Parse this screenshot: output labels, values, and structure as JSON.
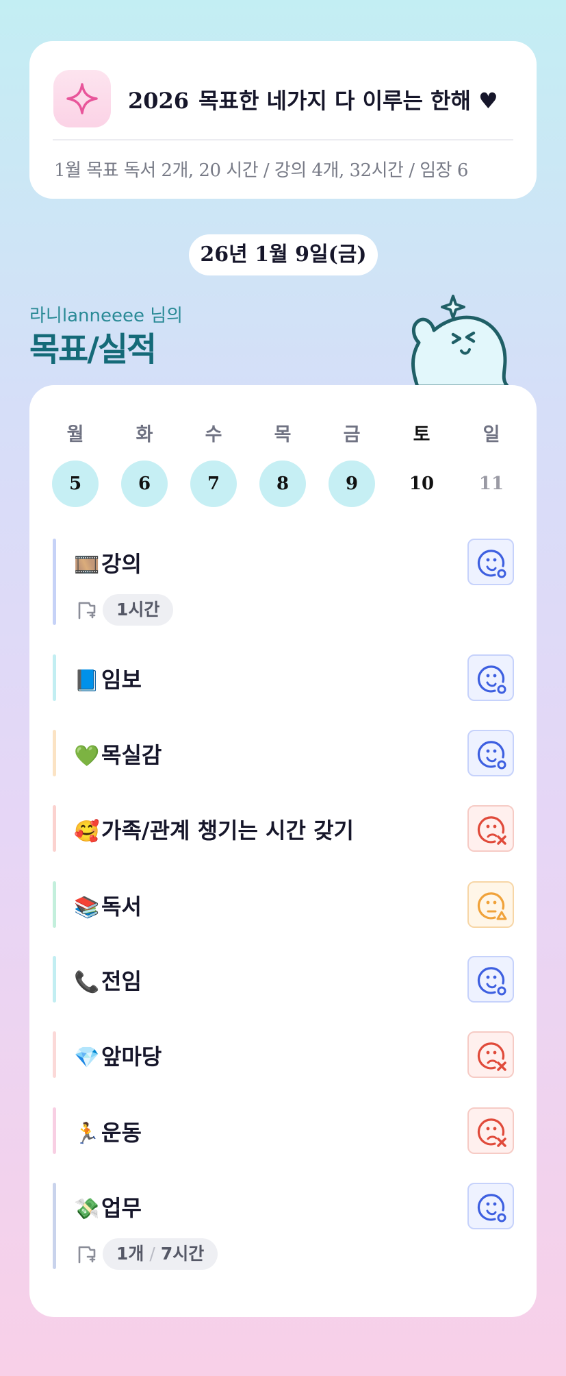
{
  "header": {
    "year": "2026",
    "title": "목표한 네가지 다 이루는 한해 ♥",
    "goal": "1월 목표   독서 2개, 20 시간 /  강의 4개,  32시간 /  임장 6",
    "icon": "sparkle-icon"
  },
  "date": "26년 1월 9일(금)",
  "user": "라니lanneeee 님의",
  "heading": "목표/실적",
  "week": {
    "days": [
      "월",
      "화",
      "수",
      "목",
      "금",
      "토",
      "일"
    ],
    "dates": [
      "5",
      "6",
      "7",
      "8",
      "9",
      "10",
      "11"
    ],
    "done": [
      true,
      true,
      true,
      true,
      true,
      false,
      false
    ]
  },
  "goals": [
    {
      "emoji": "🎞️",
      "title": "강의",
      "status": "ok",
      "bar": "#c6d2f7",
      "chips": [
        "1시간"
      ]
    },
    {
      "emoji": "📘",
      "title": "임보",
      "status": "ok",
      "bar": "#c2eef2",
      "chips": []
    },
    {
      "emoji": "💚",
      "title": "목실감",
      "status": "ok",
      "bar": "#fbe3c4",
      "chips": []
    },
    {
      "emoji": "🥰",
      "title": "가족/관계 챙기는 시간 갖기",
      "status": "fail",
      "bar": "#fbd2cf",
      "chips": []
    },
    {
      "emoji": "📚",
      "title": "독서",
      "status": "partial",
      "bar": "#c3efdc",
      "chips": []
    },
    {
      "emoji": "📞",
      "title": "전임",
      "status": "ok",
      "bar": "#c2eef2",
      "chips": []
    },
    {
      "emoji": "💎",
      "title": "앞마당",
      "status": "fail",
      "bar": "#fbd9d8",
      "chips": []
    },
    {
      "emoji": "🏃",
      "title": "운동",
      "status": "fail",
      "bar": "#f8cfe3",
      "chips": []
    },
    {
      "emoji": "💸",
      "title": "업무",
      "status": "ok",
      "bar": "#c9d3ec",
      "chips": [
        "1개",
        "7시간"
      ]
    }
  ],
  "colors": {
    "ok": "#3d5fe0",
    "fail": "#e04a3a",
    "partial": "#f0a23a",
    "accent": "#146a78"
  }
}
